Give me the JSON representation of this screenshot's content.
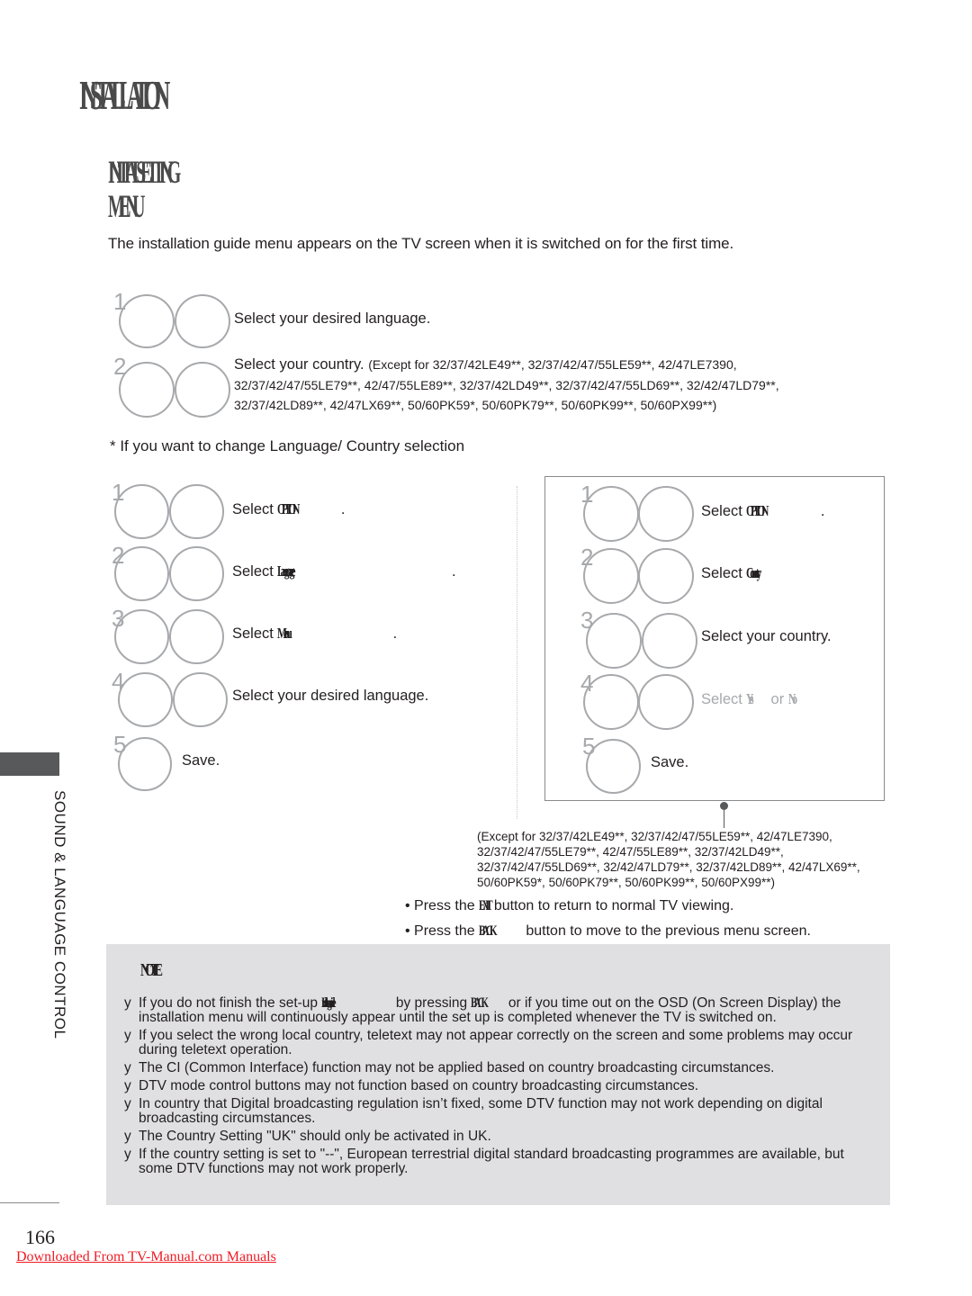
{
  "header": {
    "title_garbled": "INSTALLATION",
    "subtitle_line1_garbled": "INITIAL SETTING",
    "subtitle_line2_garbled": "MENU"
  },
  "intro": "The installation guide menu appears on the TV screen when it is switched on for the first time.",
  "initial_steps": [
    {
      "num": "1",
      "text": "Select your desired language."
    },
    {
      "num": "2",
      "text": "Select your country.",
      "note_line1": "(Except for 32/37/42LE49**, 32/37/42/47/55LE59**, 42/47LE7390,",
      "note_line2": "32/37/42/47/55LE79**, 42/47/55LE89**, 32/37/42LD49**, 32/37/42/47/55LD69**, 32/42/47LD79**,",
      "note_line3": "32/37/42LD89**, 42/47LX69**, 50/60PK59*, 50/60PK79**, 50/60PK99**, 50/60PX99**)"
    }
  ],
  "change_heading": "* If you want to change Language/ Country selection",
  "left_steps": [
    {
      "num": "1",
      "prefix": "Select ",
      "garbled": "OPTION",
      "suffix": "."
    },
    {
      "num": "2",
      "prefix": "Select ",
      "garbled": "Language",
      "suffix": "."
    },
    {
      "num": "3",
      "prefix": "Select ",
      "garbled": "Menu",
      "suffix": "."
    },
    {
      "num": "4",
      "text": "Select your desired language."
    },
    {
      "num": "5",
      "text": "Save."
    }
  ],
  "right_steps": [
    {
      "num": "1",
      "prefix": "Select ",
      "garbled": "OPTION",
      "suffix": "."
    },
    {
      "num": "2",
      "prefix": "Select ",
      "garbled": "Country"
    },
    {
      "num": "3",
      "text": "Select your country."
    },
    {
      "num": "4",
      "prefix": "Select ",
      "garbled_a": "Yes",
      "mid": " or ",
      "garbled_b": "No"
    },
    {
      "num": "5",
      "text": "Save."
    }
  ],
  "except_note": [
    "(Except for 32/37/42LE49**, 32/37/42/47/55LE59**, 42/47LE7390,",
    "32/37/42/47/55LE79**, 42/47/55LE89**, 32/37/42LD49**,",
    "32/37/42/47/55LD69**, 32/42/47LD79**, 32/37/42LD89**, 42/47LX69**,",
    "50/60PK59*, 50/60PK79**, 50/60PK99**, 50/60PX99**)"
  ],
  "bullets": [
    {
      "prefix": "Press the ",
      "garbled": "EXIT",
      "suffix": "button to return to normal TV viewing."
    },
    {
      "prefix": "Press the ",
      "garbled": "BACK",
      "suffix": " button to move to the previous menu screen."
    }
  ],
  "note": {
    "title_garbled": "NOTE",
    "items": [
      {
        "text_a": "If you do not finish the set-up ",
        "garbled_a": "Installation guide",
        "text_b": " by pressing ",
        "garbled_b": "BACK",
        "text_c": " or if you time out on the OSD (On Screen Display) the installation menu will continuously appear until the set up is completed whenever the TV is switched on."
      },
      {
        "text": "If you select the wrong local country, teletext may not appear correctly on the screen and some problems may occur during teletext operation."
      },
      {
        "text": "The CI (Common Interface) function may not be applied based on country broadcasting circumstances."
      },
      {
        "text": "DTV mode control buttons may not function based on country broadcasting circumstances."
      },
      {
        "text": "In country that Digital broadcasting regulation isn’t fixed, some DTV function may not work depending on digital broadcasting circumstances."
      },
      {
        "text": "The Country Setting \"UK\" should only be activated in UK."
      },
      {
        "text": "If the country setting is set to \"--\", European terrestrial digital standard broadcasting programmes are available, but some DTV functions may not work properly."
      }
    ],
    "bullet_char": "y"
  },
  "sidebar": {
    "label": "SOUND & LANGUAGE CONTROL"
  },
  "footer": {
    "page_number": "166",
    "link_text": "Downloaded From TV-Manual.com Manuals"
  }
}
